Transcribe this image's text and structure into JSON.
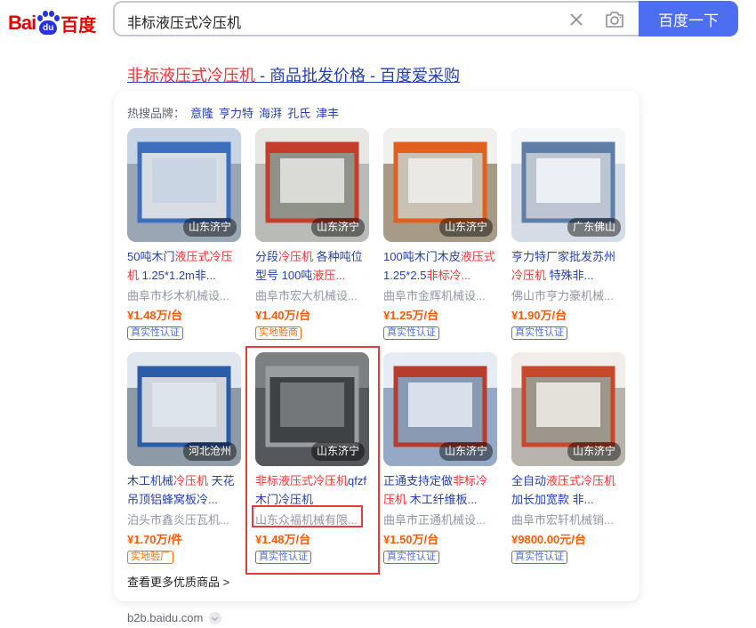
{
  "header": {
    "logo_text_left": "Bai",
    "logo_text_paw": "du",
    "logo_text_right": "百度",
    "search_query": "非标液压式冷压机",
    "search_button": "百度一下"
  },
  "result": {
    "title_highlight": "非标液压式冷压机",
    "title_rest": " - 商品批发价格 - 百度爱采购"
  },
  "brands": {
    "label": "热搜品牌：",
    "items": [
      "意隆",
      "亨力特",
      "海湃",
      "孔氏",
      "津丰"
    ]
  },
  "products": [
    {
      "location": "山东济宁",
      "name_parts": [
        {
          "t": "50吨木门",
          "h": false
        },
        {
          "t": "液压式冷压机",
          "h": true
        },
        {
          "t": " 1.25*1.2m非...",
          "h": false
        }
      ],
      "seller": "曲阜市杉木机械设...",
      "price": "¥1.48万/台",
      "tag": "真实性认证",
      "tag_color": "blue"
    },
    {
      "location": "山东济宁",
      "name_parts": [
        {
          "t": "分段",
          "h": false
        },
        {
          "t": "冷压机",
          "h": true
        },
        {
          "t": " 各种吨位型号 100吨",
          "h": false
        },
        {
          "t": "液压...",
          "h": true
        }
      ],
      "seller": "曲阜市宏大机械设...",
      "price": "¥1.40万/台",
      "tag": "实地验商",
      "tag_color": "orange"
    },
    {
      "location": "山东济宁",
      "name_parts": [
        {
          "t": "100吨木门木皮",
          "h": false
        },
        {
          "t": "液压式",
          "h": true
        },
        {
          "t": " 1.25*2.5",
          "h": false
        },
        {
          "t": "非标冷...",
          "h": true
        }
      ],
      "seller": "曲阜市金辉机械设...",
      "price": "¥1.25万/台",
      "tag": "真实性认证",
      "tag_color": "blue"
    },
    {
      "location": "广东佛山",
      "name_parts": [
        {
          "t": "亨力特厂家批发苏州",
          "h": false
        },
        {
          "t": "冷压机",
          "h": true
        },
        {
          "t": " 特殊非...",
          "h": false
        }
      ],
      "seller": "佛山市亨力豪机械...",
      "price": "¥1.90万/台",
      "tag": "真实性认证",
      "tag_color": "blue"
    },
    {
      "location": "河北沧州",
      "name_parts": [
        {
          "t": "木工机械",
          "h": false
        },
        {
          "t": "冷压机",
          "h": true
        },
        {
          "t": " 天花吊顶铝蜂窝板冷...",
          "h": false
        }
      ],
      "seller": "泊头市鑫炎压瓦机...",
      "price": "¥1.70万/件",
      "tag": "实地验厂",
      "tag_color": "orange"
    },
    {
      "location": "山东济宁",
      "name_parts": [
        {
          "t": "非标液压式冷压机",
          "h": true
        },
        {
          "t": "qfzf木门冷压机",
          "h": false
        }
      ],
      "seller": "山东众福机械有限...",
      "price": "¥1.48万/台",
      "tag": "真实性认证",
      "tag_color": "blue"
    },
    {
      "location": "山东济宁",
      "name_parts": [
        {
          "t": "正通支持定做",
          "h": false
        },
        {
          "t": "非标冷压机",
          "h": true
        },
        {
          "t": " 木工纤维板...",
          "h": false
        }
      ],
      "seller": "曲阜市正通机械设...",
      "price": "¥1.50万/台",
      "tag": "真实性认证",
      "tag_color": "blue"
    },
    {
      "location": "山东济宁",
      "name_parts": [
        {
          "t": "全自动",
          "h": false
        },
        {
          "t": "液压式冷压机",
          "h": true
        },
        {
          "t": " 加长加宽款 非...",
          "h": false
        }
      ],
      "seller": "曲阜市宏轩机械销...",
      "price": "¥9800.00元/台",
      "tag": "真实性认证",
      "tag_color": "blue"
    }
  ],
  "more_link": "查看更多优质商品 >",
  "footer_url": "b2b.baidu.com",
  "colors": {
    "accent": "#4e6ef2",
    "link": "#2440b3",
    "highlight": "#f73131",
    "price": "#ff5a00",
    "annotation": "#e63b3b"
  }
}
